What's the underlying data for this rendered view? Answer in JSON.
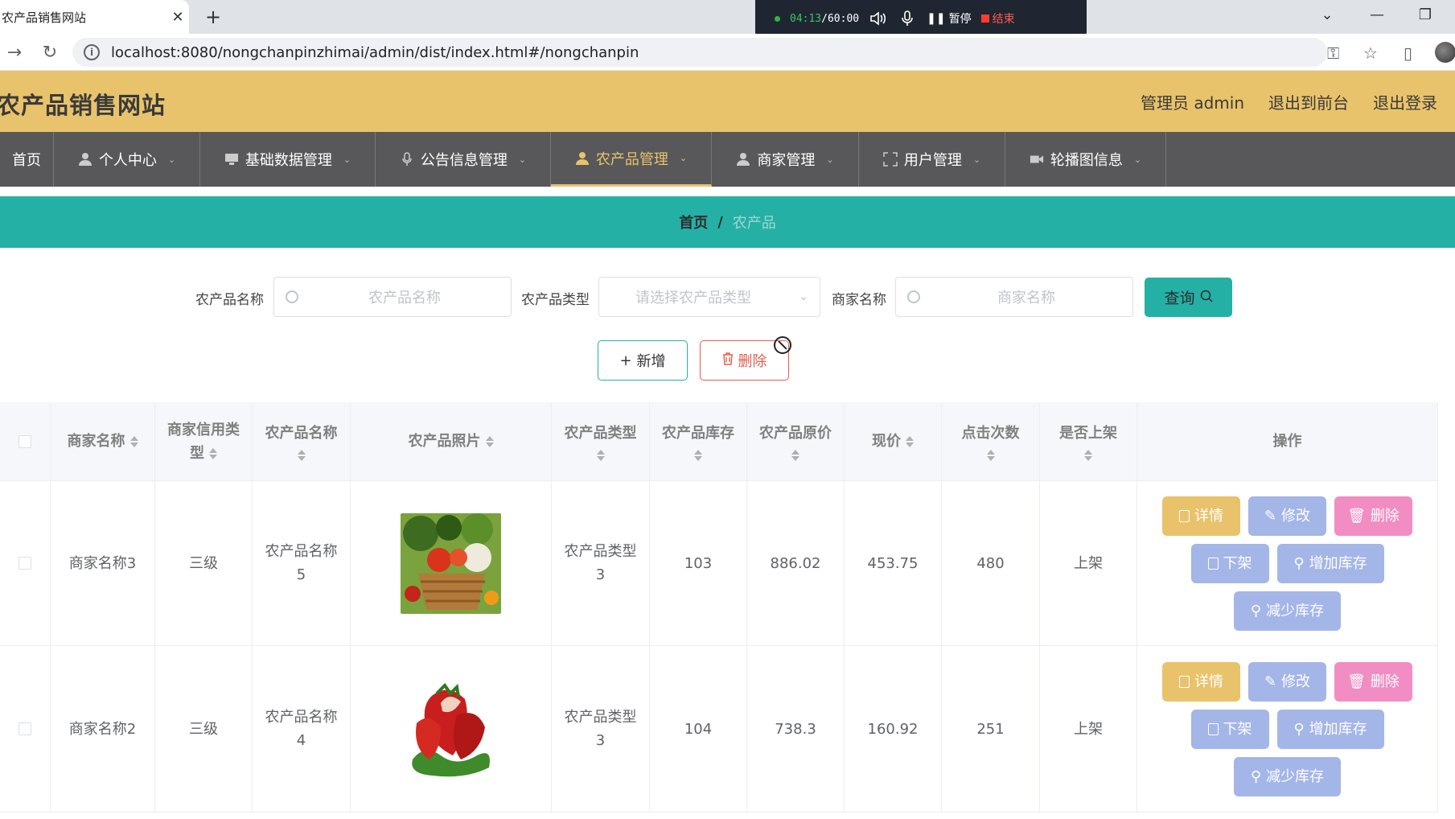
{
  "browser": {
    "tab_title": "农产品销售网站",
    "tab_close": "✕",
    "new_tab": "+",
    "url": "localhost:8080/nongchanpinzhimai/admin/dist/index.html#/nongchanpin",
    "recorder": {
      "time_elapsed": "04:13",
      "time_total": "/60:00",
      "pause_label": "暂停",
      "stop_label": "结束"
    }
  },
  "header": {
    "site_title": "农产品销售网站",
    "admin_label": "管理员 admin",
    "back_front_label": "退出到前台",
    "logout_label": "退出登录"
  },
  "nav": {
    "items": [
      {
        "label": "首页"
      },
      {
        "label": "个人中心"
      },
      {
        "label": "基础数据管理"
      },
      {
        "label": "公告信息管理"
      },
      {
        "label": "农产品管理",
        "active": true
      },
      {
        "label": "商家管理"
      },
      {
        "label": "用户管理"
      },
      {
        "label": "轮播图信息"
      }
    ]
  },
  "breadcrumb": {
    "home": "首页",
    "separator": "/",
    "current": "农产品"
  },
  "search": {
    "name_label": "农产品名称",
    "name_placeholder": "农产品名称",
    "type_label": "农产品类型",
    "type_placeholder": "请选择农产品类型",
    "merchant_label": "商家名称",
    "merchant_placeholder": "商家名称",
    "query_label": "查询"
  },
  "actions": {
    "add_label": "新增",
    "delete_label": "删除"
  },
  "table": {
    "columns": [
      "商家名称",
      "商家信用类型",
      "农产品名称",
      "农产品照片",
      "农产品类型",
      "农产品库存",
      "农产品原价",
      "现价",
      "点击次数",
      "是否上架",
      "操作"
    ],
    "rows": [
      {
        "merchant": "商家名称3",
        "credit": "三级",
        "name": "农产品名称5",
        "photo": "vegetable-basket-photo",
        "type": "农产品类型3",
        "stock": "103",
        "orig_price": "886.02",
        "price": "453.75",
        "clicks": "480",
        "on_shelf": "上架"
      },
      {
        "merchant": "商家名称2",
        "credit": "三级",
        "name": "农产品名称4",
        "photo": "strawberry-photo",
        "type": "农产品类型3",
        "stock": "104",
        "orig_price": "738.3",
        "price": "160.92",
        "clicks": "251",
        "on_shelf": "上架"
      }
    ],
    "row_buttons": {
      "detail": "详情",
      "edit": "修改",
      "delete": "删除",
      "off_shelf": "下架",
      "add_stock": "增加库存",
      "reduce_stock": "减少库存"
    }
  },
  "colors": {
    "header_bg": "#e8c36b",
    "nav_bg": "#58585a",
    "accent_teal": "#25b0a5",
    "danger": "#e35d4e",
    "btn_blue": "#a4b5e8",
    "btn_pink": "#f28dc3"
  }
}
